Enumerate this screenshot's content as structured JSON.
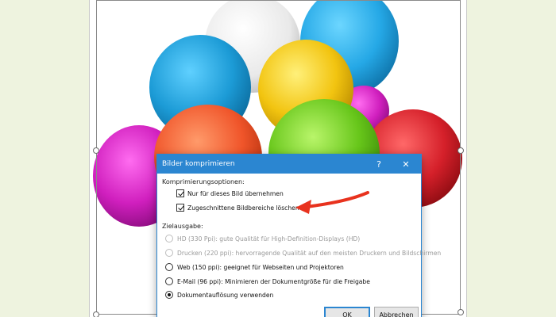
{
  "dialog": {
    "title": "Bilder komprimieren",
    "help_glyph": "?",
    "close_glyph": "✕",
    "compression_section_label": "Komprimierungsoptionen:",
    "compression_options": [
      {
        "label": "Nur für dieses Bild übernehmen",
        "checked": true
      },
      {
        "label": "Zugeschnittene Bildbereiche löschen",
        "checked": true
      }
    ],
    "output_section_label": "Zielausgabe:",
    "output_options": [
      {
        "label": "HD (330 Ppi): gute Qualität für High-Definition-Displays (HD)",
        "enabled": false,
        "selected": false
      },
      {
        "label": "Drucken (220 ppi): hervorragende Qualität auf den meisten Druckern und Bildschirmen",
        "enabled": false,
        "selected": false
      },
      {
        "label": "Web (150 ppi): geeignet für Webseiten und Projektoren",
        "enabled": true,
        "selected": false
      },
      {
        "label": "E-Mail (96 ppi): Minimieren der Dokumentgröße für die Freigabe",
        "enabled": true,
        "selected": false
      },
      {
        "label": "Dokumentauflösung verwenden",
        "enabled": true,
        "selected": true
      }
    ],
    "ok_label": "OK",
    "cancel_label": "Abbrechen"
  },
  "colors": {
    "accent_blue": "#2b86d1",
    "annotation_arrow": "#e8321e",
    "page_background": "#eef3df"
  },
  "image": {
    "subject": "balloons-illustration",
    "balloon_colors": [
      "#ffffff",
      "#1e9fd6",
      "#29aee8",
      "#f3c613",
      "#d11fc0",
      "#f0572a",
      "#69c81b",
      "#d9202a"
    ]
  }
}
